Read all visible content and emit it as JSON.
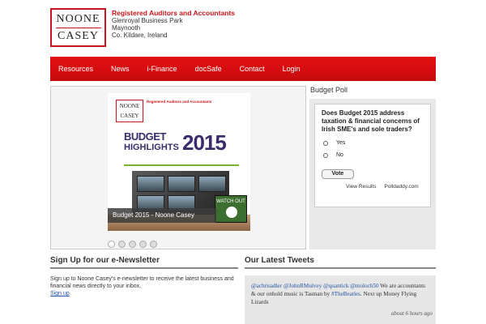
{
  "brand": {
    "logo_top": "NOONE",
    "logo_bottom": "CASEY",
    "tagline": "Registered Auditors and Accountants",
    "address_lines": [
      "Glenroyal Business Park",
      "Maynooth",
      "Co. Kildare, Ireland"
    ]
  },
  "nav": {
    "items": [
      "Resources",
      "News",
      "i-Finance",
      "docSafe",
      "Contact",
      "Login"
    ]
  },
  "slider": {
    "caption": "Budget 2015 - Noone Casey",
    "slide": {
      "logo_top": "NOONE",
      "logo_bottom": "CASEY",
      "firm_label": "Registered Auditors and Accountants",
      "budget_word": "BUDGET",
      "highlights_word": "HIGHLIGHTS",
      "year": "2015",
      "watch_label": "WATCH OUT"
    },
    "dots": 5,
    "active_dot": 0
  },
  "poll": {
    "title": "Budget Poll",
    "question": "Does Budget 2015 address taxation & financial concerns of Irish SME's and sole traders?",
    "options": [
      "Yes",
      "No"
    ],
    "vote_label": "Vote",
    "view_results": "View Results",
    "polldaddy": "Polldaddy.com"
  },
  "widgets": {
    "left_title": "Sign Up for our e-Newsletter",
    "left_text": "Sign up to Noone Casey's e-newsletter to receive the latest business and financial news directly to your inbox.",
    "left_link": "Sign up",
    "right_title": "Our Latest Tweets",
    "tweet": {
      "handles": "@achrisadler @JohnRMulvey @quantick @moloch50",
      "text_a": " We are accountants & our onhold music is Tasman by ",
      "hashtag": "#TheBeatles",
      "text_b": ". Next up Money Flying Lizards",
      "time": "about 6 hours ago"
    }
  }
}
